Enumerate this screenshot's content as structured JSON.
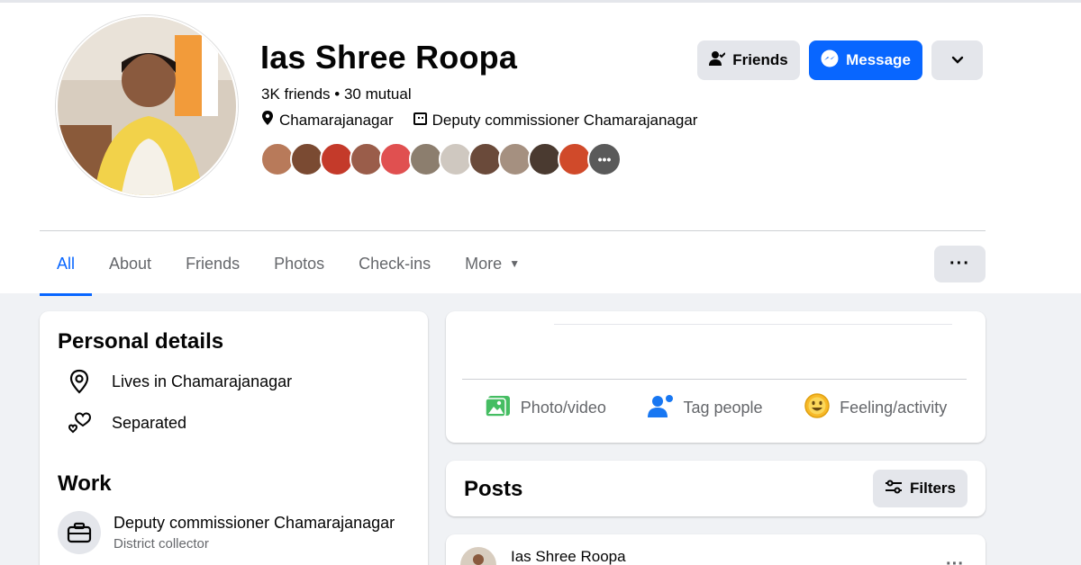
{
  "profile": {
    "name": "Ias Shree Roopa",
    "friends_summary": "3K friends • 30 mutual",
    "location": "Chamarajanagar",
    "workplace": "Deputy commissioner Chamarajanagar"
  },
  "header_buttons": {
    "friends_label": "Friends",
    "message_label": "Message"
  },
  "tabs": [
    {
      "label": "All",
      "active": true
    },
    {
      "label": "About"
    },
    {
      "label": "Friends"
    },
    {
      "label": "Photos"
    },
    {
      "label": "Check-ins"
    },
    {
      "label": "More"
    }
  ],
  "personal_details": {
    "title": "Personal details",
    "lives_in": "Lives in Chamarajanagar",
    "relationship": "Separated"
  },
  "work": {
    "title": "Work",
    "job_title": "Deputy commissioner Chamarajanagar",
    "job_subtitle": "District collector"
  },
  "create_post": {
    "photo_video": "Photo/video",
    "tag_people": "Tag people",
    "feeling_activity": "Feeling/activity"
  },
  "posts": {
    "title": "Posts",
    "filters_label": "Filters",
    "first_post_author": "Ias Shree Roopa"
  },
  "colors": {
    "accent": "#0866ff",
    "button_grey": "#e4e6eb",
    "page_bg": "#f0f2f5"
  }
}
